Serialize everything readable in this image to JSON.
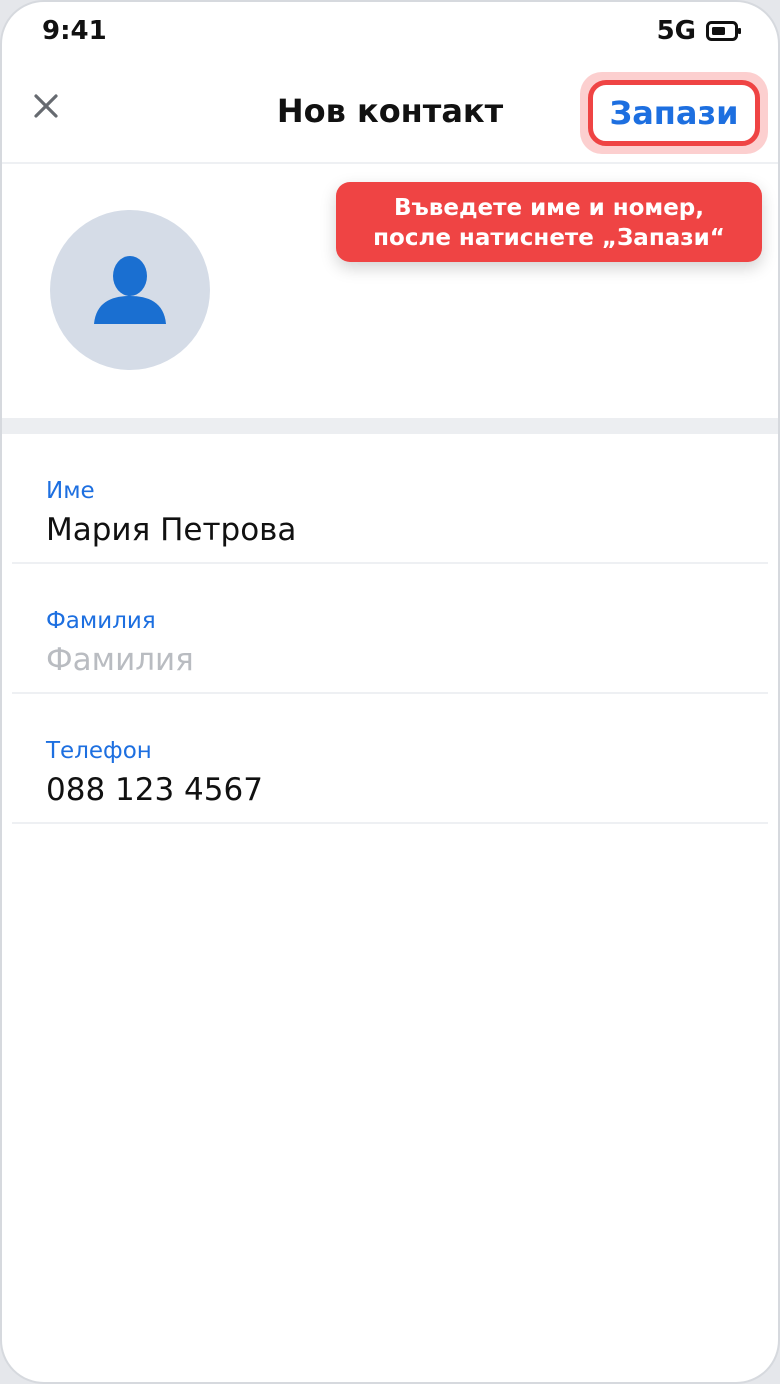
{
  "status_bar": {
    "time": "9:41",
    "network": "5G",
    "battery_icon": "battery-icon"
  },
  "header": {
    "close_icon": "close-icon",
    "title": "Нов контакт",
    "save_label": "Запази"
  },
  "avatar": {
    "icon": "person-icon"
  },
  "hint": {
    "line1": "Въведете име и номер,",
    "line2": "после натиснете „Запази“"
  },
  "form": {
    "first_name": {
      "label": "Име",
      "value": "Мария Петрова",
      "placeholder": ""
    },
    "last_name": {
      "label": "Фамилия",
      "value": "",
      "placeholder": "Фамилия"
    },
    "phone": {
      "label": "Телефон",
      "value": "088 123 4567",
      "placeholder": ""
    }
  },
  "colors": {
    "accent": "#1d6fe0",
    "highlight": "#ef4444",
    "avatar_bg": "#d5dce7",
    "avatar_icon": "#1a6fd1"
  }
}
